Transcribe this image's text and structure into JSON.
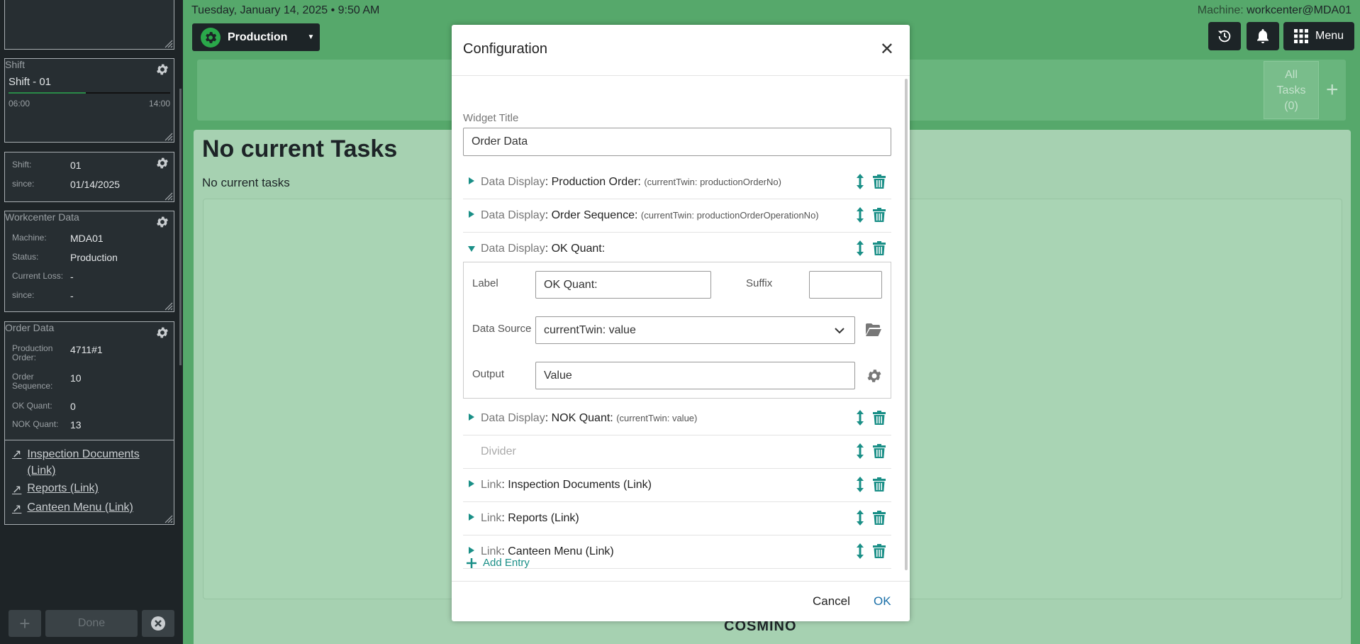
{
  "topbar": {
    "datetime": "Tuesday, January 14, 2025 • 9:50 AM",
    "status_button": "Production",
    "machine_label": "Machine:",
    "machine_value": "workcenter@MDA01",
    "menu_label": "Menu"
  },
  "tasks": {
    "all_tasks_line1": "All",
    "all_tasks_line2": "Tasks",
    "all_tasks_count": "(0)",
    "heading": "No current Tasks",
    "subtext": "No current tasks"
  },
  "brand": "COSMINO",
  "sidebar": {
    "shift_widget": {
      "title": "Shift",
      "name": "Shift - 01",
      "start": "06:00",
      "end": "14:00",
      "progress": 0.48
    },
    "shift_info": {
      "rows": [
        {
          "key": "Shift:",
          "value": "01"
        },
        {
          "key": "since:",
          "value": "01/14/2025"
        }
      ]
    },
    "workcenter": {
      "title": "Workcenter Data",
      "rows": [
        {
          "key": "Machine:",
          "value": "MDA01"
        },
        {
          "key": "Status:",
          "value": "Production"
        },
        {
          "key": "Current Loss:",
          "value": "-"
        },
        {
          "key": "since:",
          "value": "-"
        }
      ]
    },
    "order": {
      "title": "Order Data",
      "rows": [
        {
          "key": "Production Order:",
          "value": "4711#1"
        },
        {
          "key": "Order Sequence:",
          "value": "10"
        },
        {
          "key": "OK Quant:",
          "value": "0"
        },
        {
          "key": "NOK Quant:",
          "value": "13"
        }
      ],
      "links": [
        "Inspection Documents (Link)",
        "Reports (Link)",
        "Canteen Menu (Link)"
      ]
    },
    "done_button": "Done"
  },
  "modal": {
    "title": "Configuration",
    "widget_title_label": "Widget Title",
    "widget_title_value": "Order Data",
    "entries": [
      {
        "type": "Data Display",
        "label": ": Production Order:",
        "source": "(currentTwin: productionOrderNo)"
      },
      {
        "type": "Data Display",
        "label": ": Order Sequence:",
        "source": "(currentTwin: productionOrderOperationNo)"
      },
      {
        "type": "Data Display",
        "label": ": OK Quant:",
        "source": ""
      },
      {
        "type": "Data Display",
        "label": ": NOK Quant:",
        "source": "(currentTwin: value)"
      },
      {
        "type": "Divider",
        "label": "",
        "source": ""
      },
      {
        "type": "Link",
        "label": ": Inspection Documents (Link)",
        "source": ""
      },
      {
        "type": "Link",
        "label": ": Reports (Link)",
        "source": ""
      },
      {
        "type": "Link",
        "label": ": Canteen Menu (Link)",
        "source": ""
      }
    ],
    "expanded": {
      "label_label": "Label",
      "label_value": "OK Quant:",
      "suffix_label": "Suffix",
      "suffix_value": "",
      "source_label": "Data Source",
      "source_value": "currentTwin: value",
      "output_label": "Output",
      "output_value": "Value"
    },
    "add_entry": "Add Entry",
    "cancel": "Cancel",
    "ok": "OK"
  },
  "colors": {
    "accent": "#1a8f87",
    "main_bg": "#56a86b",
    "sidebar_bg": "#1e2427"
  }
}
